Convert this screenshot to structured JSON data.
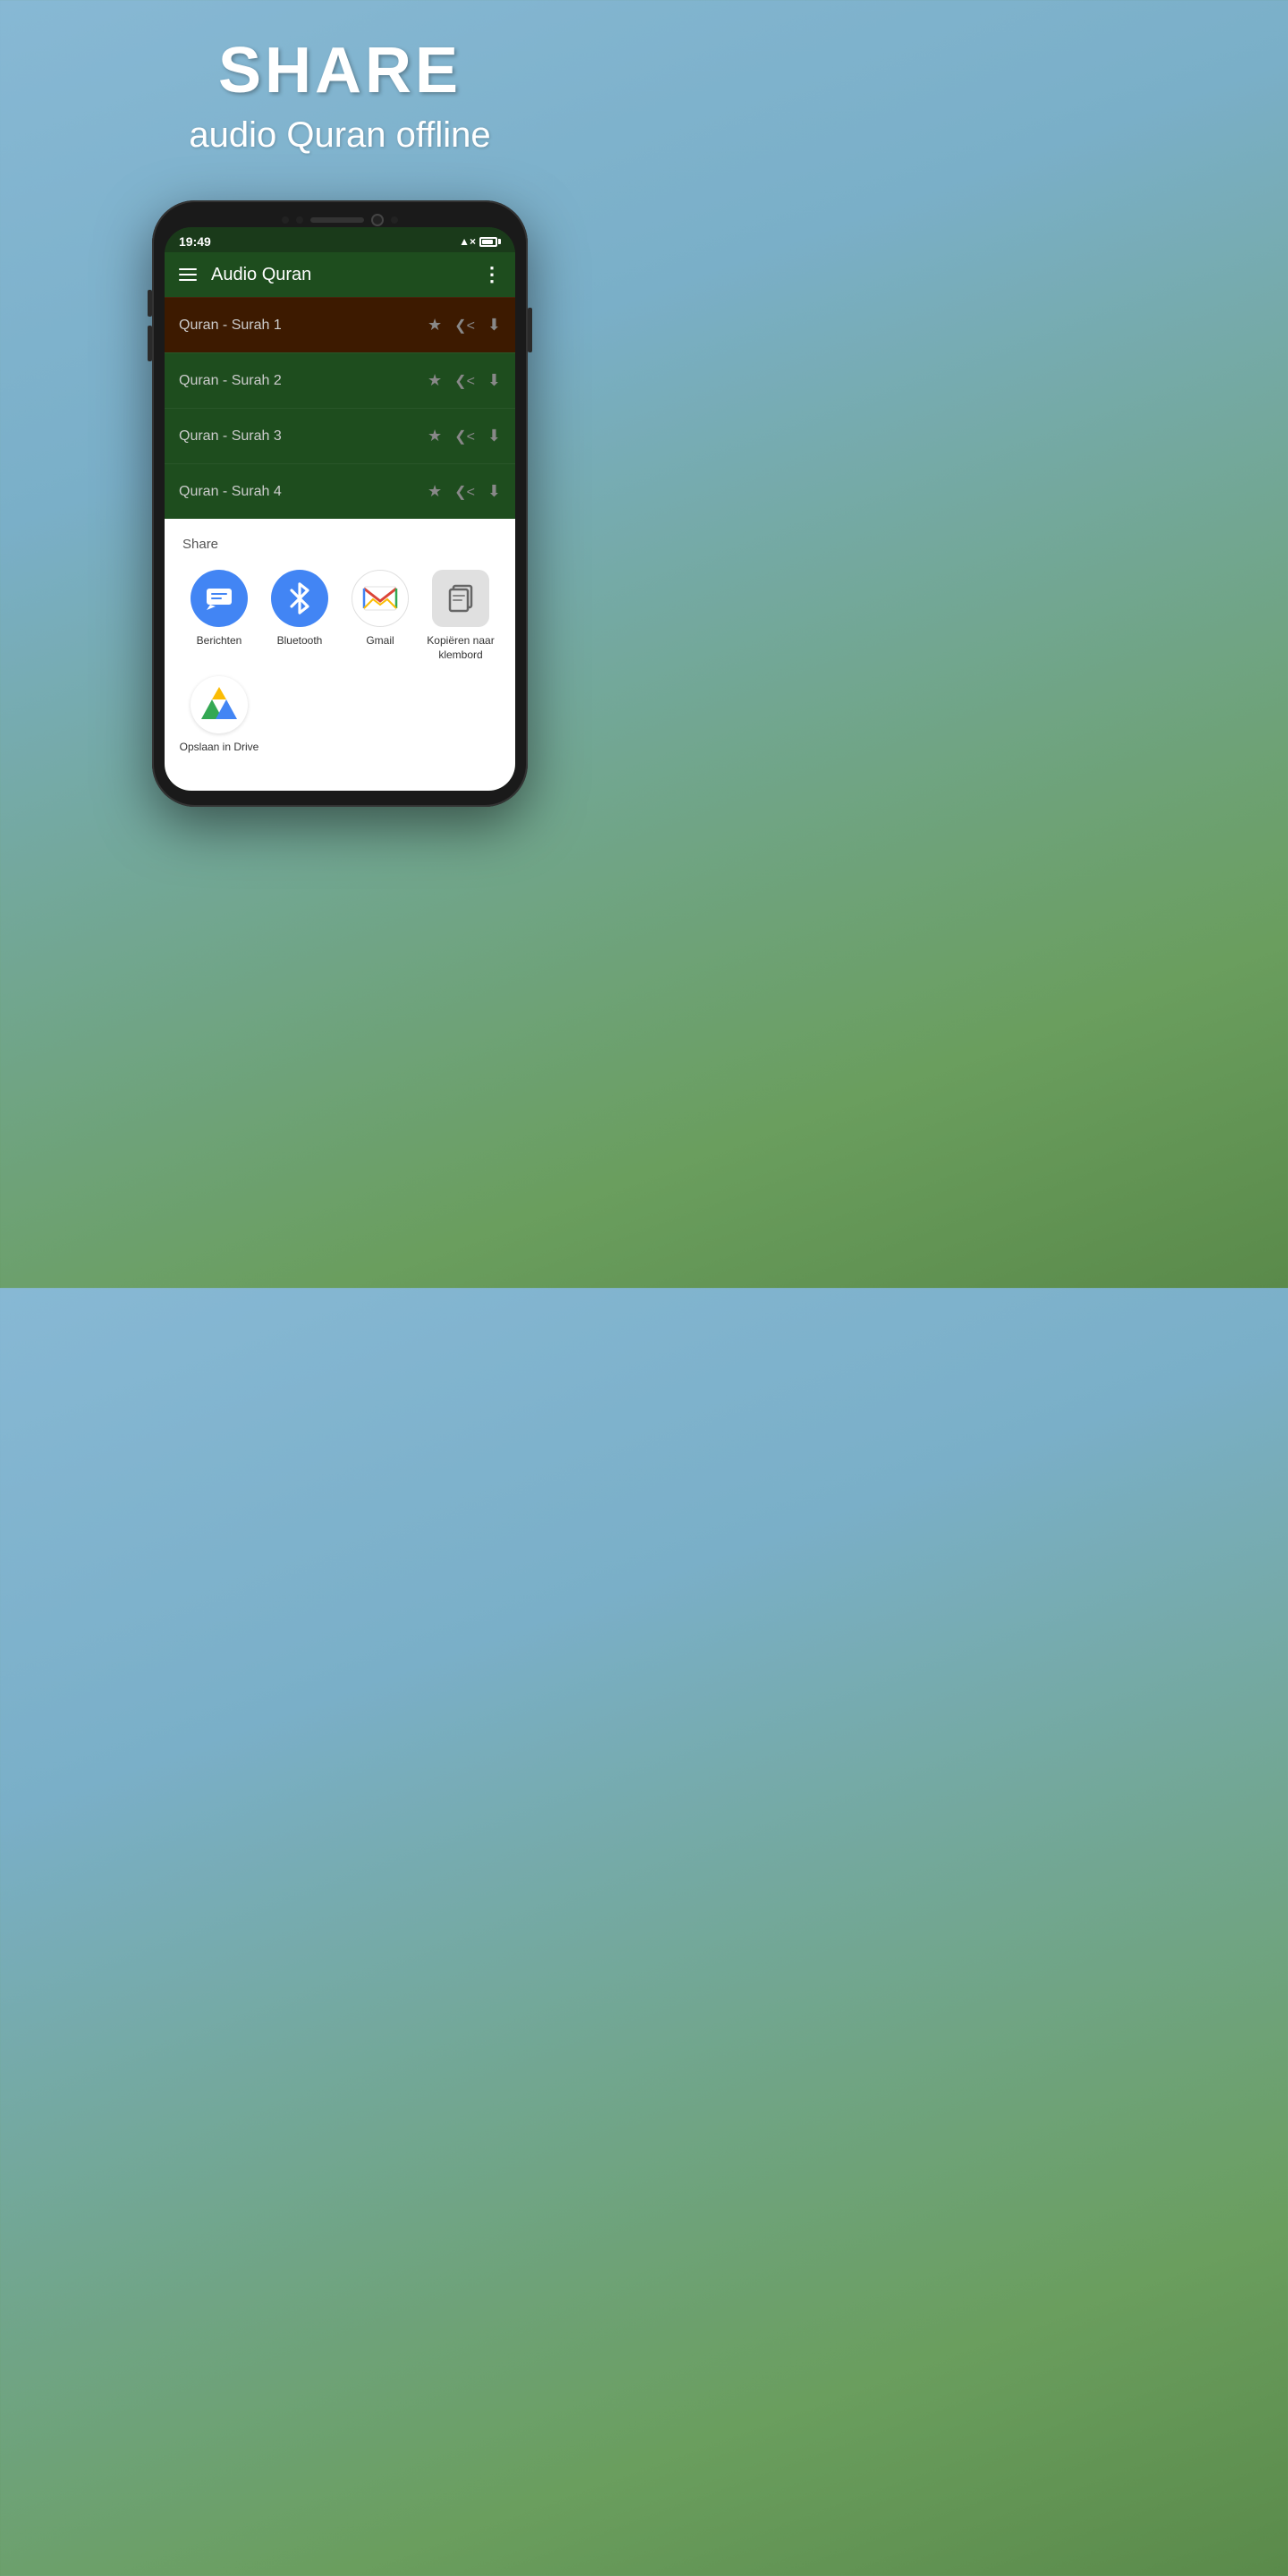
{
  "promo": {
    "title": "SHARE",
    "subtitle": "audio Quran offline"
  },
  "status_bar": {
    "time": "19:49"
  },
  "app_bar": {
    "title": "Audio Quran"
  },
  "surah_list": [
    {
      "name": "Quran - Surah 1",
      "highlighted": true
    },
    {
      "name": "Quran - Surah 2",
      "highlighted": false
    },
    {
      "name": "Quran - Surah 3",
      "highlighted": false
    },
    {
      "name": "Quran - Surah 4",
      "highlighted": false
    }
  ],
  "share_sheet": {
    "title": "Share",
    "apps": [
      {
        "id": "berichten",
        "label": "Berichten"
      },
      {
        "id": "bluetooth",
        "label": "Bluetooth"
      },
      {
        "id": "gmail",
        "label": "Gmail"
      },
      {
        "id": "copy",
        "label": "Kopiëren naar\nklembord"
      }
    ],
    "apps_row2": [
      {
        "id": "drive",
        "label": "Opslaan in\nDrive"
      }
    ]
  }
}
